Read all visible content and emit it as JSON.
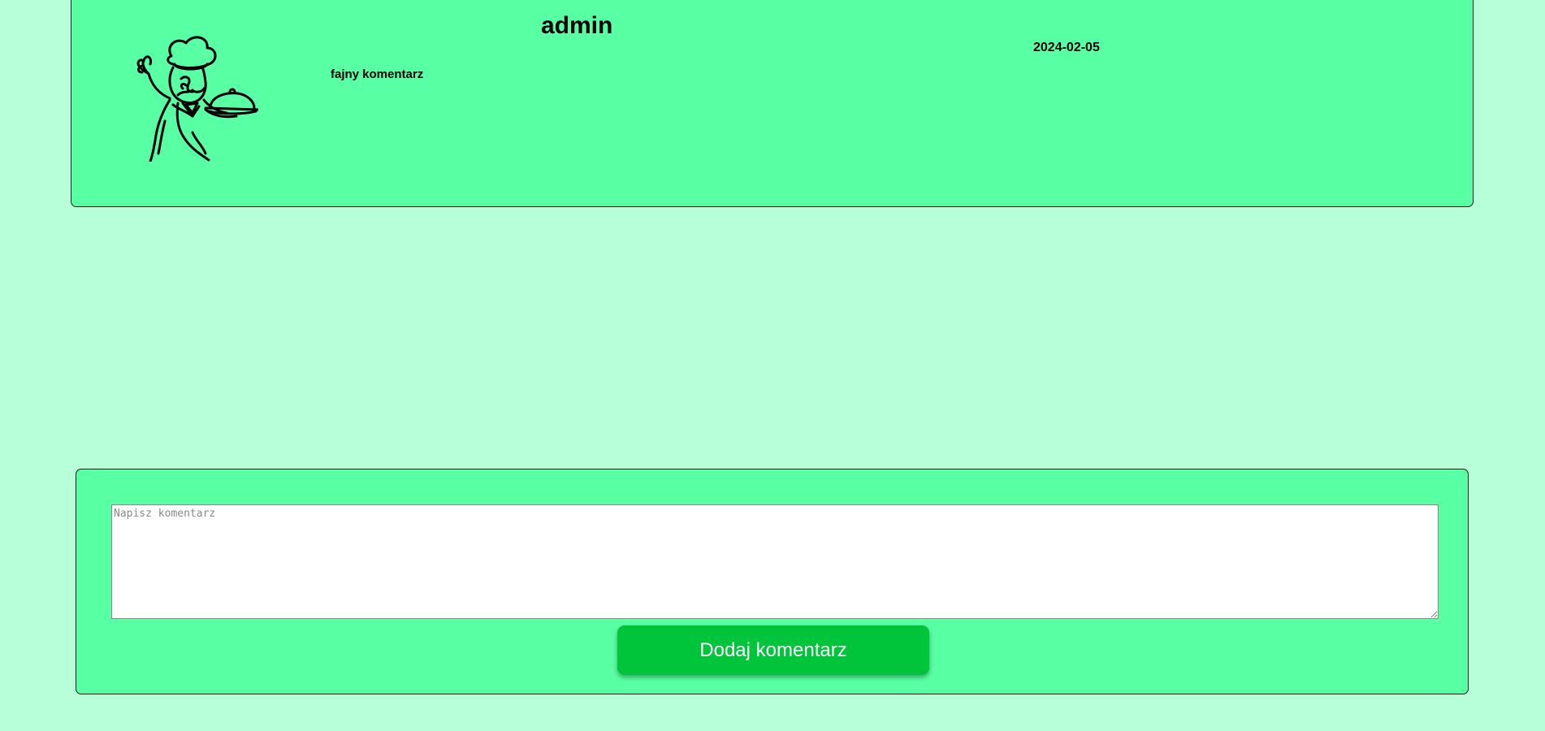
{
  "comment": {
    "username": "admin",
    "text": "fajny komentarz",
    "date": "2024-02-05",
    "avatar_icon": "chef-waiter-icon"
  },
  "form": {
    "placeholder": "Napisz komentarz",
    "value": "",
    "submit_label": "Dodaj komentarz"
  },
  "colors": {
    "page_background": "#b7ffd9",
    "card_background": "#58ffa3",
    "button_background": "#00c43a",
    "button_text": "#ffffff"
  }
}
